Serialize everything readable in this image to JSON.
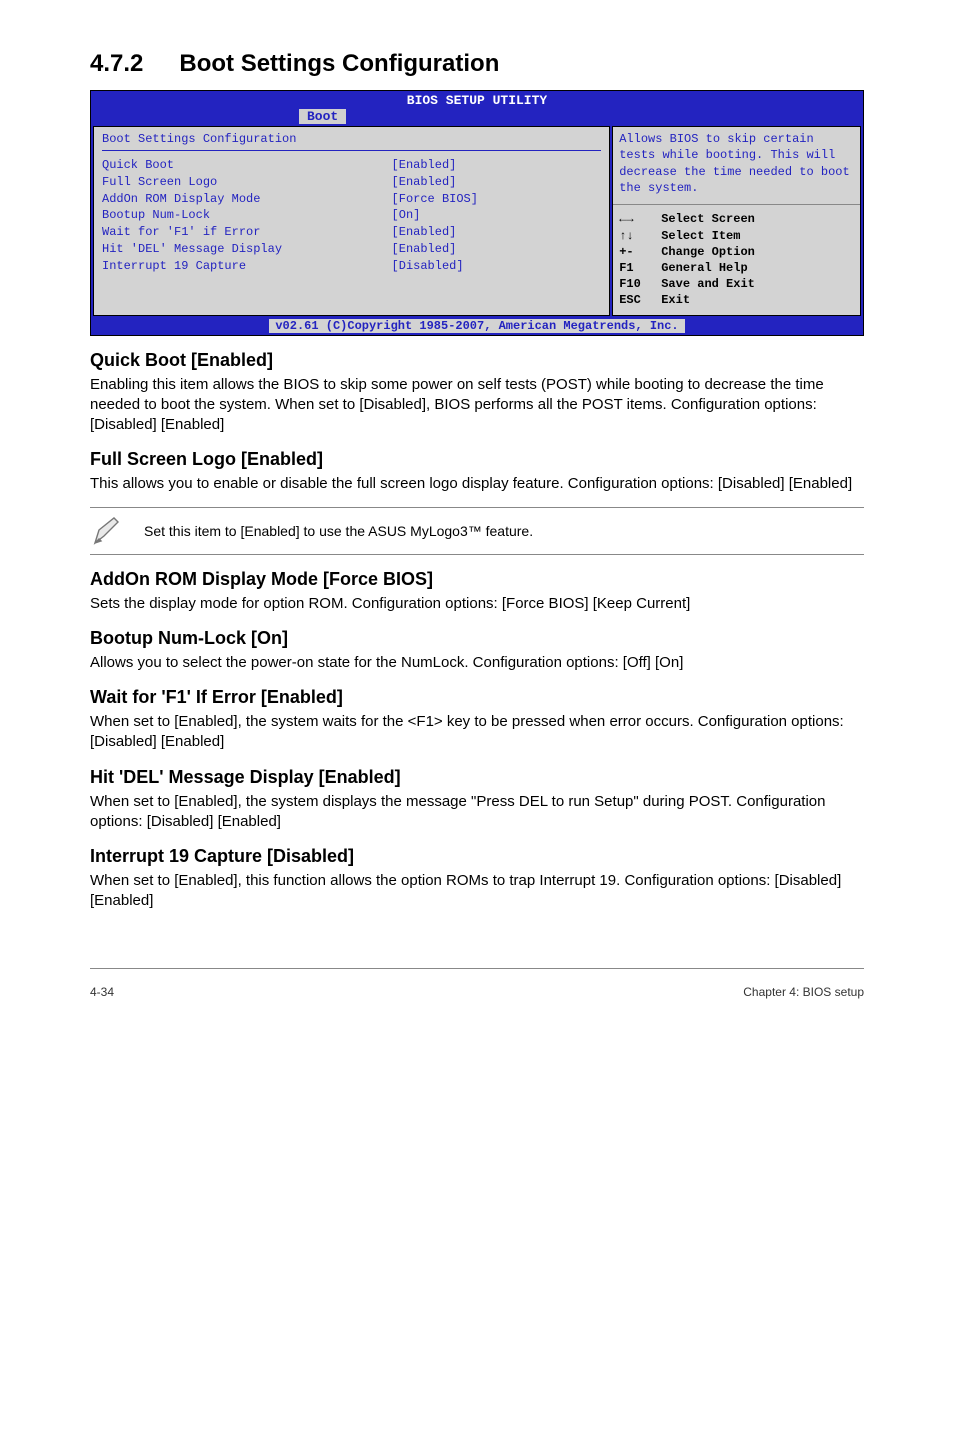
{
  "section": {
    "number": "4.7.2",
    "title": "Boot Settings Configuration"
  },
  "bios": {
    "utility_title": "BIOS SETUP UTILITY",
    "tab": "Boot",
    "heading": "Boot Settings Configuration",
    "items": [
      {
        "label": "Quick Boot",
        "value": "[Enabled]"
      },
      {
        "label": "Full Screen Logo",
        "value": "[Enabled]"
      },
      {
        "label": "AddOn ROM Display Mode",
        "value": "[Force BIOS]"
      },
      {
        "label": "Bootup Num-Lock",
        "value": "[On]"
      },
      {
        "label": "Wait for 'F1' if Error",
        "value": "[Enabled]"
      },
      {
        "label": "Hit 'DEL' Message Display",
        "value": "[Enabled]"
      },
      {
        "label": "Interrupt 19 Capture",
        "value": "[Disabled]"
      }
    ],
    "help_text": "Allows BIOS to skip certain tests while booting. This will decrease the time needed to boot the system.",
    "keys": [
      {
        "k": "←→",
        "d": "Select Screen"
      },
      {
        "k": "↑↓",
        "d": "Select Item"
      },
      {
        "k": "+-",
        "d": "Change Option"
      },
      {
        "k": "F1",
        "d": "General Help"
      },
      {
        "k": "F10",
        "d": "Save and Exit"
      },
      {
        "k": "ESC",
        "d": "Exit"
      }
    ],
    "footer": "v02.61 (C)Copyright 1985-2007, American Megatrends, Inc."
  },
  "content": {
    "quick_boot": {
      "h": "Quick Boot [Enabled]",
      "p": "Enabling this item allows the BIOS to skip some power on self tests (POST) while booting to decrease the time needed to boot the system. When set to [Disabled], BIOS performs all the POST items. Configuration options: [Disabled] [Enabled]"
    },
    "full_screen_logo": {
      "h": "Full Screen Logo [Enabled]",
      "p": "This allows you to enable or disable the full screen logo display feature. Configuration options: [Disabled] [Enabled]"
    },
    "note": "Set this item to [Enabled] to use the ASUS MyLogo3™ feature.",
    "addon_rom": {
      "h": "AddOn ROM Display Mode [Force BIOS]",
      "p": "Sets the display mode for option ROM. Configuration options: [Force BIOS] [Keep Current]"
    },
    "bootup_numlock": {
      "h": "Bootup Num-Lock [On]",
      "p": "Allows you to select the power-on state for the NumLock. Configuration options: [Off] [On]"
    },
    "wait_f1": {
      "h": "Wait for 'F1' If Error [Enabled]",
      "p": "When set to [Enabled], the system waits for the <F1> key to be pressed when error occurs. Configuration options: [Disabled] [Enabled]"
    },
    "hit_del": {
      "h": "Hit 'DEL' Message Display [Enabled]",
      "p": "When set to [Enabled], the system displays the message \"Press DEL to run Setup\" during POST. Configuration options: [Disabled] [Enabled]"
    },
    "int19": {
      "h": "Interrupt 19 Capture [Disabled]",
      "p": "When set to [Enabled], this function allows the option ROMs to trap Interrupt 19. Configuration options: [Disabled] [Enabled]"
    }
  },
  "footer": {
    "page": "4-34",
    "chapter": "Chapter 4: BIOS setup"
  }
}
